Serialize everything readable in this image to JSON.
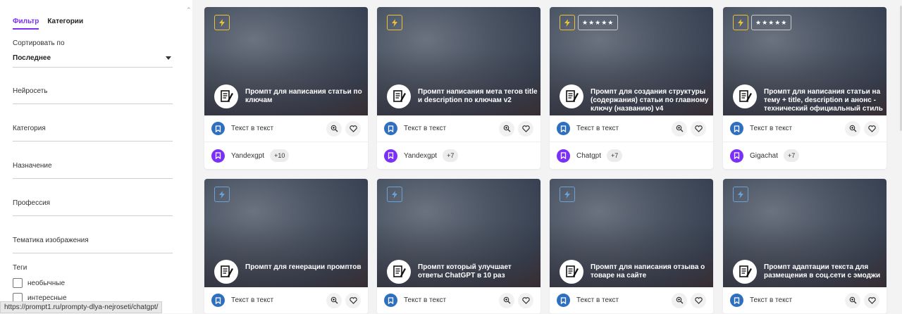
{
  "sidebar": {
    "tabs": [
      "Фильтр",
      "Категории"
    ],
    "sort_label": "Сортировать по",
    "sort_value": "Последнее",
    "fields": [
      "Нейросеть",
      "Категория",
      "Назначение",
      "Профессия",
      "Тематика изображения"
    ],
    "tags_title": "Теги",
    "tags": [
      "необычные",
      "интересные"
    ]
  },
  "status_url": "https://prompt1.ru/prompty-dlya-nejroseti/chatgpt/",
  "colors": {
    "accent": "#7b2ff7",
    "blue_icon": "#2f6fc0",
    "purple_icon": "#7b2ff7",
    "bolt_yellow": "#e8c23a",
    "bolt_blue": "#6aa2d8"
  },
  "cards": [
    {
      "title": "Промпт для написания статьи по ключам",
      "type": "Текст в текст",
      "model": "Yandexgpt",
      "extra": "+10",
      "stars": "",
      "bolt": "yellow"
    },
    {
      "title": "Промпт написания мета тегов title и description по ключам v2",
      "type": "Текст в текст",
      "model": "Yandexgpt",
      "extra": "+7",
      "stars": "",
      "bolt": "yellow"
    },
    {
      "title": "Промпт для создания структуры (содержания) статьи по главному ключу (названию) v4",
      "type": "Текст в текст",
      "model": "Chatgpt",
      "extra": "+7",
      "stars": "★★★★★",
      "bolt": "yellow"
    },
    {
      "title": "Промпт для написания статьи на тему + title, description и анонс - технический официальный стиль",
      "type": "Текст в текст",
      "model": "Gigachat",
      "extra": "+7",
      "stars": "★★★★★",
      "bolt": "yellow"
    },
    {
      "title": "Промпт для генерации промптов",
      "type": "Текст в текст",
      "model": "",
      "extra": "",
      "stars": "",
      "bolt": "blue"
    },
    {
      "title": "Промпт который улучшает ответы ChatGPT в 10 раз",
      "type": "Текст в текст",
      "model": "",
      "extra": "",
      "stars": "",
      "bolt": "blue"
    },
    {
      "title": "Промпт для написания отзыва о товаре на сайте",
      "type": "Текст в текст",
      "model": "",
      "extra": "",
      "stars": "",
      "bolt": "blue"
    },
    {
      "title": "Промпт адаптации текста для размещения в соц.сети с эмоджи",
      "type": "Текст в текст",
      "model": "",
      "extra": "",
      "stars": "",
      "bolt": "blue"
    }
  ]
}
